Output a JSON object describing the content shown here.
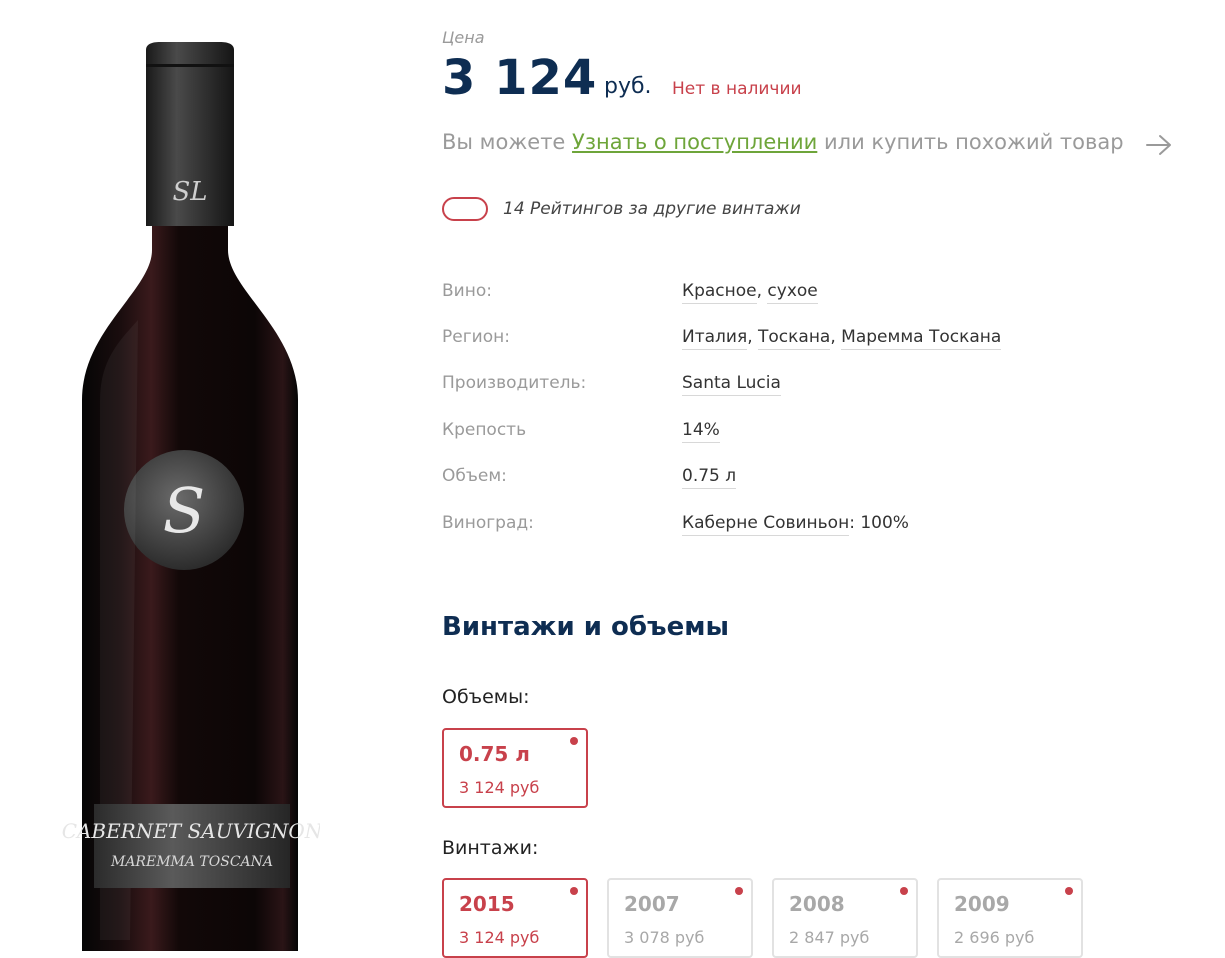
{
  "bottle": {
    "label_line1": "CABERNET SAUVIGNON",
    "label_line2": "MAREMMA TOSCANA"
  },
  "price": {
    "caption": "Цена",
    "value": "3 124",
    "currency": "руб.",
    "stock_status": "Нет в наличии"
  },
  "notify": {
    "prefix": "Вы можете",
    "link": "Узнать о поступлении",
    "suffix": "или купить похожий товар"
  },
  "rating": {
    "text": "14 Рейтингов за другие винтажи"
  },
  "attributes": [
    {
      "label": "Вино:",
      "values": [
        "Красное",
        "сухое"
      ],
      "suffix": ""
    },
    {
      "label": "Регион:",
      "values": [
        "Италия",
        "Тоскана",
        "Маремма Тоскана"
      ],
      "suffix": ""
    },
    {
      "label": "Производитель:",
      "values": [
        "Santa Lucia"
      ],
      "suffix": ""
    },
    {
      "label": "Крепость",
      "values": [
        "14%"
      ],
      "suffix": ""
    },
    {
      "label": "Объем:",
      "values": [
        "0.75 л"
      ],
      "suffix": ""
    },
    {
      "label": "Виноград:",
      "values": [
        "Каберне Совиньон"
      ],
      "suffix": ": 100%"
    }
  ],
  "vintages_section": {
    "title": "Винтажи и объемы",
    "volumes_label": "Объемы:",
    "volumes": [
      {
        "main": "0.75 л",
        "price": "3 124 руб",
        "active": true
      }
    ],
    "vintages_label": "Винтажи:",
    "vintages": [
      {
        "main": "2015",
        "price": "3 124 руб",
        "active": true
      },
      {
        "main": "2007",
        "price": "3 078 руб",
        "active": false
      },
      {
        "main": "2008",
        "price": "2 847 руб",
        "active": false
      },
      {
        "main": "2009",
        "price": "2 696 руб",
        "active": false
      }
    ]
  },
  "colors": {
    "navy": "#0e2d52",
    "accent_red": "#c8414b",
    "link_green": "#6ea53a",
    "muted_gray": "#9a9a9a"
  }
}
